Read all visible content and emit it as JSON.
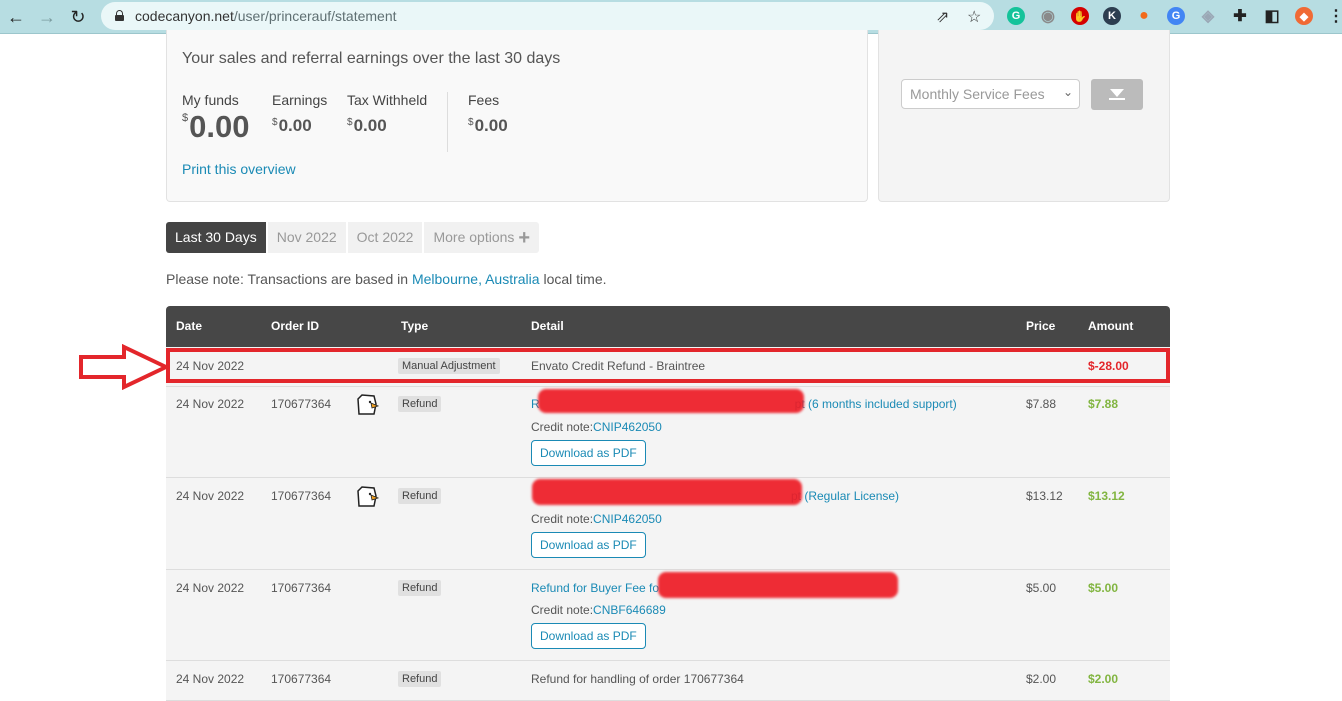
{
  "browser": {
    "url_host": "codecanyon.net",
    "url_path": "/user/princerauf/statement",
    "back_icon": "arrow-left-icon",
    "forward_icon": "arrow-right-icon",
    "reload_icon": "reload-icon",
    "share_icon": "share-icon",
    "bookmark_icon": "star-icon",
    "extensions": [
      {
        "name": "grammarly-extension-icon",
        "glyph": "G",
        "color": "#15c39a"
      },
      {
        "name": "camera-extension-icon",
        "glyph": "◉",
        "color": "#8a8a8a"
      },
      {
        "name": "adblock-extension-icon",
        "glyph": "✋",
        "color": "#d50000"
      },
      {
        "name": "k-extension-icon",
        "glyph": "K",
        "color": "#2d3e50"
      },
      {
        "name": "acorn-extension-icon",
        "glyph": "●",
        "color": "#f26a1b"
      },
      {
        "name": "translate-extension-icon",
        "glyph": "G",
        "color": "#4285f4"
      },
      {
        "name": "shield-extension-icon",
        "glyph": "◈",
        "color": "#9aa7b5"
      },
      {
        "name": "puzzle-extensions-icon",
        "glyph": "✚",
        "color": "#222222"
      },
      {
        "name": "sidepanel-icon",
        "glyph": "◧",
        "color": "#222222"
      },
      {
        "name": "profile-avatar-icon",
        "glyph": "◆",
        "color": "#f06a35"
      },
      {
        "name": "kebab-menu-icon",
        "glyph": "⋮",
        "color": "#222222"
      }
    ]
  },
  "overview": {
    "title": "Your sales and referral earnings over the last 30 days",
    "stats": [
      {
        "label": "My funds",
        "currency": "$",
        "value": "0.00"
      },
      {
        "label": "Earnings",
        "currency": "$",
        "value": "0.00"
      },
      {
        "label": "Tax Withheld",
        "currency": "$",
        "value": "0.00"
      },
      {
        "label": "Fees",
        "currency": "$",
        "value": "0.00"
      }
    ],
    "print_link": "Print this overview"
  },
  "download": {
    "select_value": "Monthly Service Fees",
    "button_icon": "download-icon"
  },
  "tabs": [
    {
      "label": "Last 30 Days",
      "active": true
    },
    {
      "label": "Nov 2022",
      "active": false
    },
    {
      "label": "Oct 2022",
      "active": false
    },
    {
      "label": "More options",
      "active": false
    }
  ],
  "note": {
    "prefix": "Please note: Transactions are based in ",
    "location": "Melbourne, Australia",
    "suffix": " local time."
  },
  "table": {
    "headers": [
      "Date",
      "Order ID",
      "Type",
      "Detail",
      "Price",
      "Amount"
    ],
    "rows": [
      {
        "date": "24 Nov 2022",
        "order_id": "",
        "type": "Manual Adjustment",
        "detail": "Envato Credit Refund - Braintree",
        "price": "",
        "amount": "$-28.00",
        "highlighted": true
      },
      {
        "date": "24 Nov 2022",
        "order_id": "170677364",
        "type": "Refund",
        "detail_prefix": "R",
        "detail_suffix": "pt (6 months included support)",
        "credit_label": "Credit note:",
        "credit_note": "CNIP462050",
        "pdf_label": "Download as PDF",
        "price": "$7.88",
        "amount": "$7.88"
      },
      {
        "date": "24 Nov 2022",
        "order_id": "170677364",
        "type": "Refund",
        "detail_prefix": "",
        "detail_suffix": "pt (Regular License)",
        "credit_label": "Credit note:",
        "credit_note": "CNIP462050",
        "pdf_label": "Download as PDF",
        "price": "$13.12",
        "amount": "$13.12"
      },
      {
        "date": "24 Nov 2022",
        "order_id": "170677364",
        "type": "Refund",
        "detail_prefix": "Refund for Buyer Fee fo",
        "detail_suffix": "",
        "credit_label": "Credit note:",
        "credit_note": "CNBF646689",
        "pdf_label": "Download as PDF",
        "price": "$5.00",
        "amount": "$5.00"
      },
      {
        "date": "24 Nov 2022",
        "order_id": "170677364",
        "type": "Refund",
        "detail": "Refund for handling of order 170677364",
        "price": "$2.00",
        "amount": "$2.00"
      }
    ]
  },
  "colors": {
    "link": "#1a8ab5",
    "positive": "#82b541",
    "negative": "#e3262b",
    "header_bg": "#474747",
    "annotation": "#e3262b"
  }
}
